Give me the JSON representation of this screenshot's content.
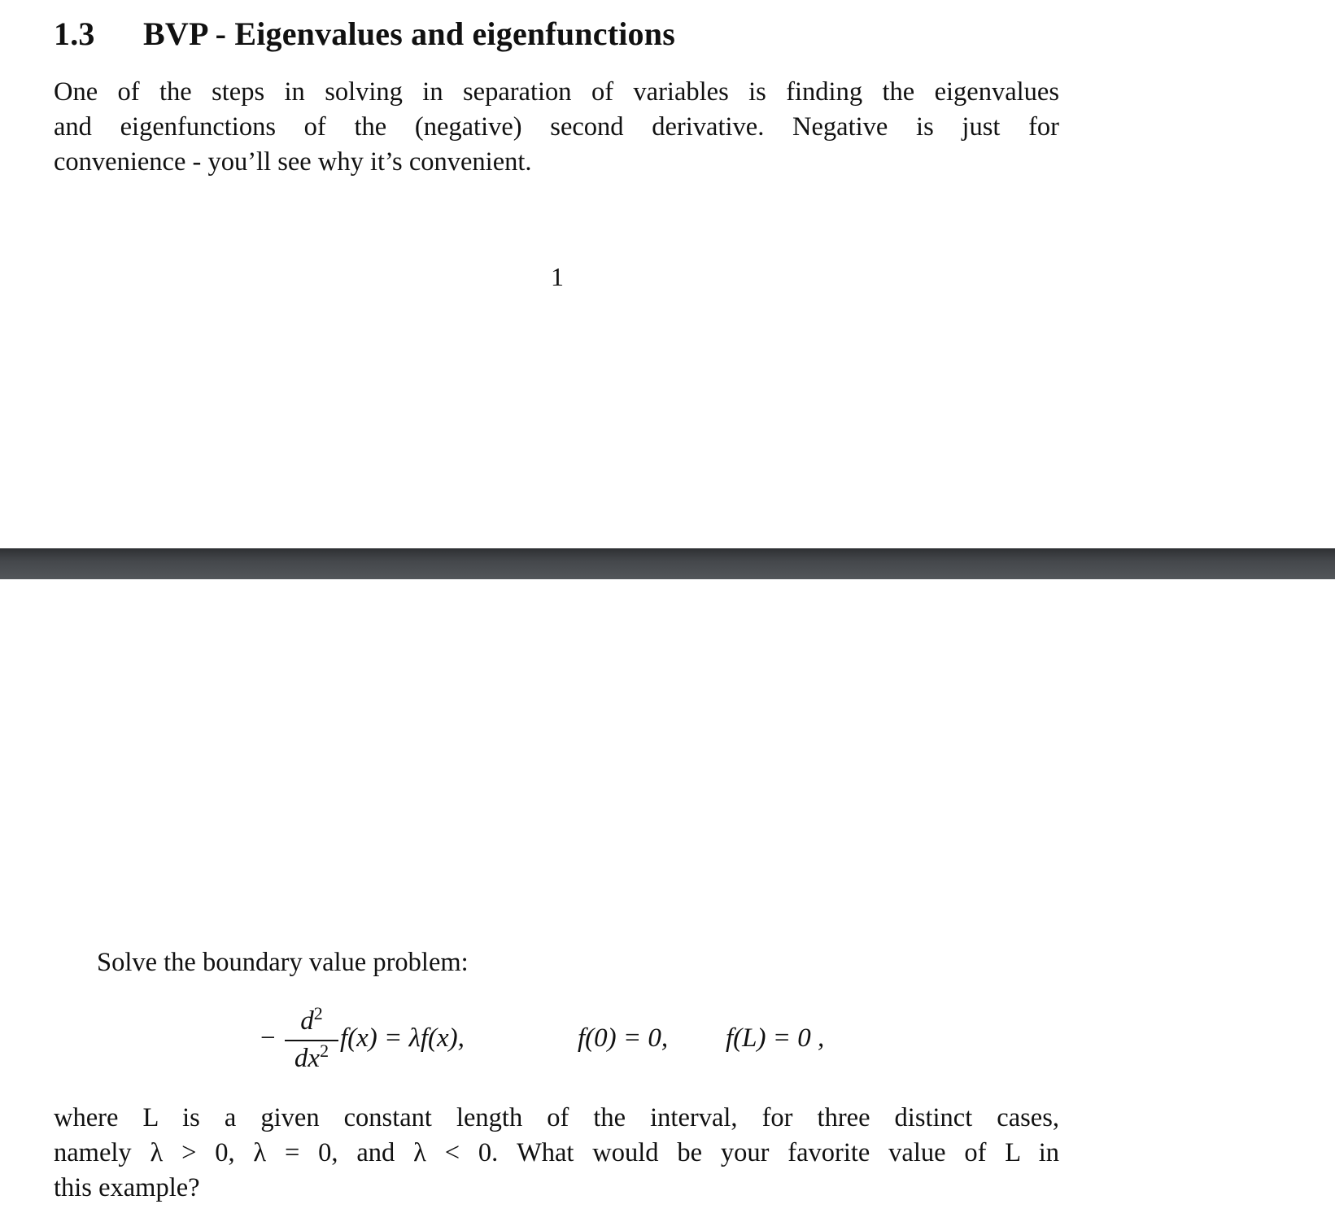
{
  "page1": {
    "section": {
      "number": "1.3",
      "title": "BVP - Eigenvalues and eigenfunctions"
    },
    "intro_lines": [
      "One of the steps in solving in separation of variables is finding the eigenvalues",
      "and eigenfunctions of the (negative) second derivative.  Negative is just for",
      "convenience - you’ll see why it’s convenient."
    ],
    "page_number": "1"
  },
  "page2": {
    "problem_intro": "Solve the boundary value problem:",
    "equation": {
      "minus": "−",
      "numerator": "d",
      "numerator_exp": "2",
      "denominator": "dx",
      "denominator_exp": "2",
      "lhs": "f(x) = λf(x),",
      "bc1": "f(0) = 0,",
      "bc2": "f(L) = 0 ,"
    },
    "conclusion_lines": [
      "where L is a given constant length of the interval, for three distinct cases,",
      "namely λ > 0, λ = 0, and λ < 0.  What would be your favorite value of L in",
      "this example?"
    ]
  },
  "colors": {
    "text": "#111111",
    "page_background": "#ffffff",
    "divider_top": "#2e3033",
    "divider_bottom": "#52565a"
  }
}
